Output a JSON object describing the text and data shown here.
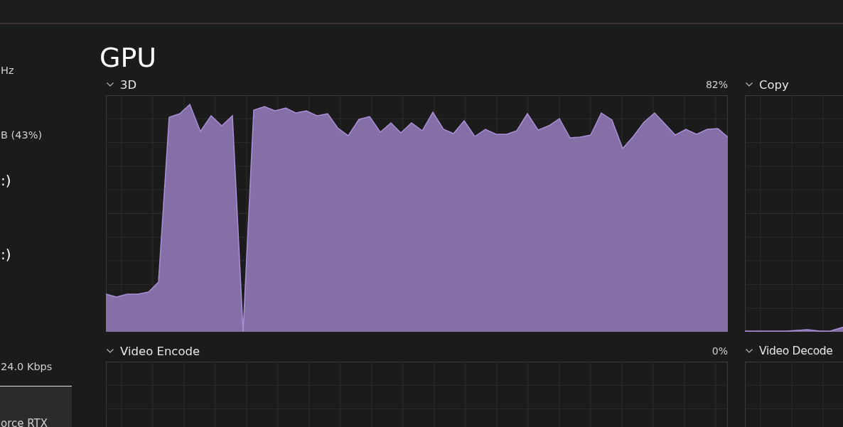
{
  "sidebar": {
    "items": [
      {
        "kind": "detail",
        "text": "Hz",
        "selected": false
      },
      {
        "kind": "detail",
        "text": "B (43%)",
        "selected": false
      },
      {
        "kind": "title",
        "text": ":)",
        "selected": false
      },
      {
        "kind": "title",
        "text": ":)",
        "selected": false
      },
      {
        "kind": "detail",
        "text": "24.0 Kbps",
        "selected": false
      },
      {
        "kind": "detail",
        "text": "orce RTX",
        "selected": true
      }
    ]
  },
  "title": "GPU",
  "engines": [
    {
      "name": "3D",
      "reading": "82%"
    },
    {
      "name": "Copy"
    },
    {
      "name": "Video Encode",
      "reading": "0%"
    },
    {
      "name": "Video Decode"
    }
  ]
}
